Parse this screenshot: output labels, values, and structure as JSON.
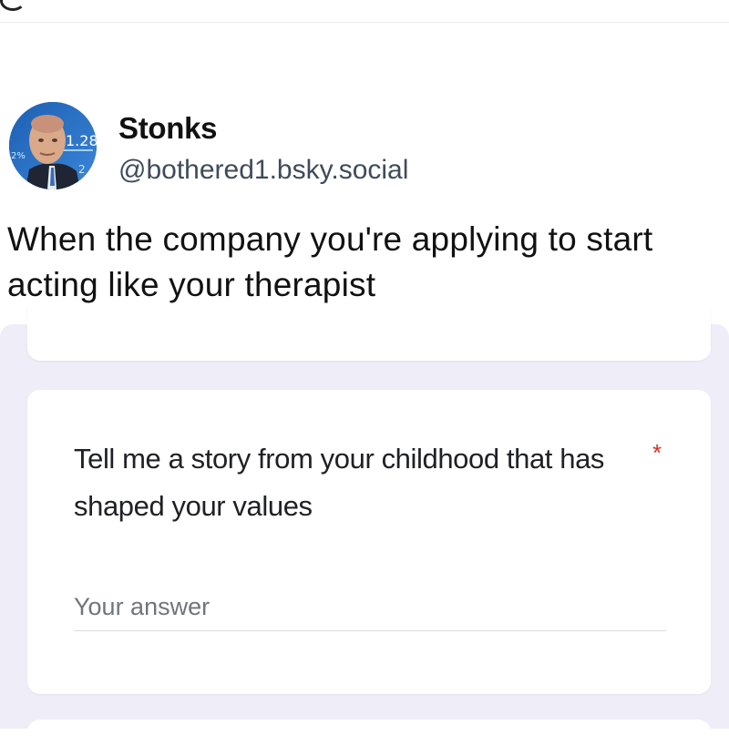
{
  "post": {
    "author_name": "Stonks",
    "author_handle": "@bothered1.bsky.social",
    "text": "When the company you're applying to start acting like your therapist",
    "avatar": {
      "icon": "stonks-meme-avatar",
      "chart_numbers": [
        "1.28",
        "2",
        "2%"
      ]
    }
  },
  "form": {
    "question": "Tell me a story from your childhood that has shaped your values",
    "required_mark": "*",
    "answer_placeholder": "Your answer",
    "answer_value": ""
  },
  "colors": {
    "form_background": "#efedf8",
    "required": "#d93025",
    "handle": "#3f4b5a"
  }
}
